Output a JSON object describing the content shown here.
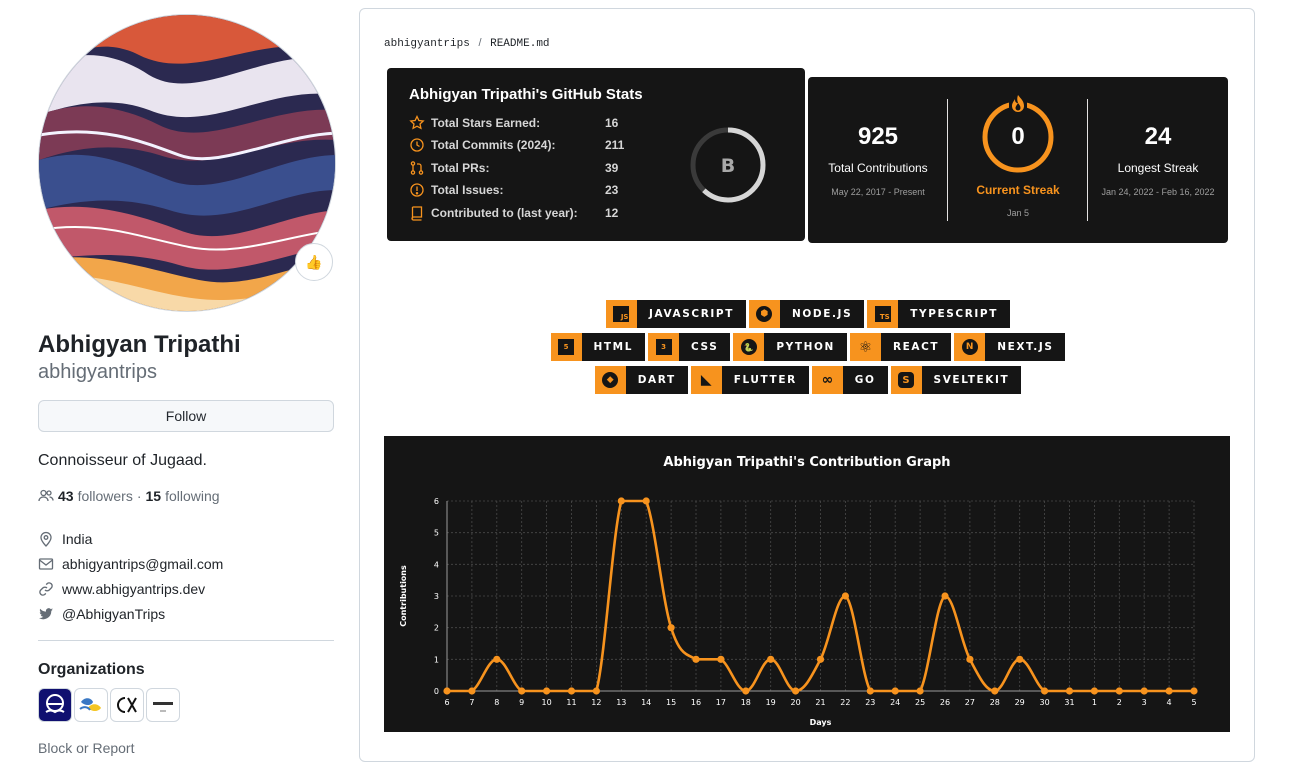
{
  "profile": {
    "name": "Abhigyan Tripathi",
    "login": "abhigyantrips",
    "status_emoji": "👍",
    "follow_label": "Follow",
    "bio": "Connoisseur of Jugaad.",
    "followers_count": "43",
    "followers_label": "followers",
    "separator": "·",
    "following_count": "15",
    "following_label": "following",
    "location": "India",
    "email": "abhigyantrips@gmail.com",
    "website": "www.abhigyantrips.dev",
    "twitter": "@AbhigyanTrips",
    "organizations_title": "Organizations",
    "block_label": "Block or Report"
  },
  "readme": {
    "owner": "abhigyantrips",
    "sep": "/",
    "file": "README.md"
  },
  "stats": {
    "title": "Abhigyan Tripathi's GitHub Stats",
    "rows": [
      {
        "label": "Total Stars Earned:",
        "value": "16",
        "icon": "star-icon"
      },
      {
        "label": "Total Commits (2024):",
        "value": "211",
        "icon": "history-icon"
      },
      {
        "label": "Total PRs:",
        "value": "39",
        "icon": "pull-request-icon"
      },
      {
        "label": "Total Issues:",
        "value": "23",
        "icon": "issue-icon"
      },
      {
        "label": "Contributed to (last year):",
        "value": "12",
        "icon": "repo-icon"
      }
    ],
    "grade": "B",
    "grade_progress": 0.62
  },
  "streak": {
    "total": "925",
    "total_label": "Total Contributions",
    "total_range": "May 22, 2017 - Present",
    "current": "0",
    "current_label": "Current Streak",
    "current_range": "Jan 5",
    "longest": "24",
    "longest_label": "Longest Streak",
    "longest_range": "Jan 24, 2022 - Feb 16, 2022"
  },
  "badges": [
    [
      {
        "glyph": "JS",
        "label": "JAVASCRIPT",
        "icon": "javascript-icon"
      },
      {
        "glyph": "⬢",
        "label": "NODE.JS",
        "icon": "nodejs-icon"
      },
      {
        "glyph": "TS",
        "label": "TYPESCRIPT",
        "icon": "typescript-icon"
      }
    ],
    [
      {
        "glyph": "5",
        "label": "HTML",
        "icon": "html5-icon"
      },
      {
        "glyph": "3",
        "label": "CSS",
        "icon": "css3-icon"
      },
      {
        "glyph": "🐍",
        "label": "PYTHON",
        "icon": "python-icon"
      },
      {
        "glyph": "⚛",
        "label": "REACT",
        "icon": "react-icon"
      },
      {
        "glyph": "N",
        "label": "NEXT.JS",
        "icon": "nextjs-icon"
      }
    ],
    [
      {
        "glyph": "◆",
        "label": "DART",
        "icon": "dart-icon"
      },
      {
        "glyph": "◣",
        "label": "FLUTTER",
        "icon": "flutter-icon"
      },
      {
        "glyph": "∞",
        "label": "GO",
        "icon": "go-icon"
      },
      {
        "glyph": "S",
        "label": "SVELTEKIT",
        "icon": "svelte-icon"
      }
    ]
  ],
  "colors": {
    "accent": "#f7931e",
    "card_bg": "#151515",
    "link": "#0969da",
    "muted": "#656d76"
  },
  "chart_data": {
    "type": "line",
    "title": "Abhigyan Tripathi's Contribution Graph",
    "xlabel": "Days",
    "ylabel": "Contributions",
    "ylim": [
      0,
      6
    ],
    "yticks": [
      0,
      1,
      2,
      3,
      4,
      5,
      6
    ],
    "grid": true,
    "categories": [
      "6",
      "7",
      "8",
      "9",
      "10",
      "11",
      "12",
      "13",
      "14",
      "15",
      "16",
      "17",
      "18",
      "19",
      "20",
      "21",
      "22",
      "23",
      "24",
      "25",
      "26",
      "27",
      "28",
      "29",
      "30",
      "31",
      "1",
      "2",
      "3",
      "4",
      "5"
    ],
    "series": [
      {
        "values": [
          0,
          0,
          1,
          0,
          0,
          0,
          0,
          6,
          6,
          2,
          1,
          1,
          0,
          1,
          0,
          1,
          3,
          0,
          0,
          0,
          3,
          1,
          0,
          1,
          0,
          0,
          0,
          0,
          0,
          0,
          0
        ]
      }
    ],
    "line_color": "#f7931e"
  }
}
